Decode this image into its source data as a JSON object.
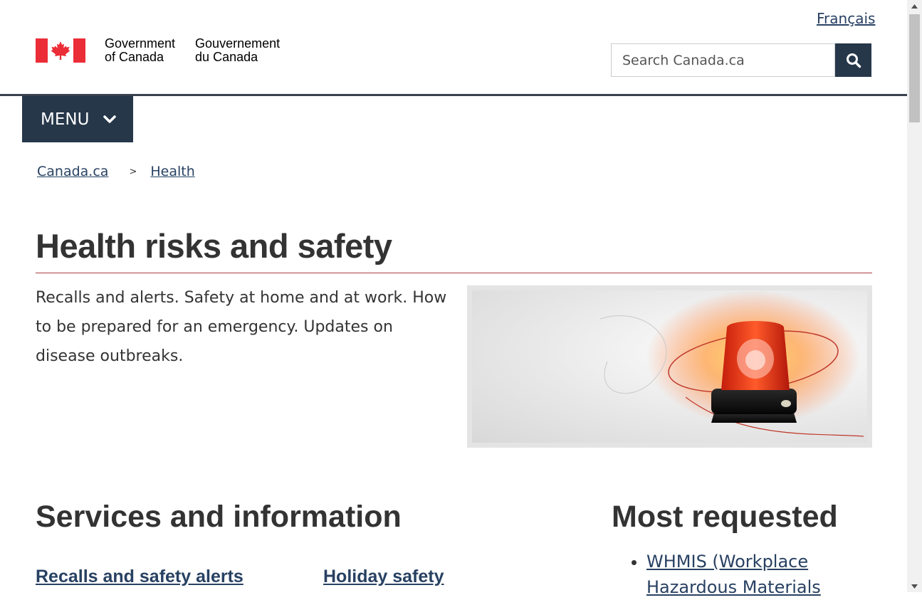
{
  "header": {
    "language_link": "Français",
    "wordmark_en": [
      "Government",
      "of Canada"
    ],
    "wordmark_fr": [
      "Gouvernement",
      "du Canada"
    ],
    "search_placeholder": "Search Canada.ca",
    "menu_label": "MENU"
  },
  "breadcrumb": {
    "items": [
      "Canada.ca",
      "Health"
    ],
    "separator": ">"
  },
  "page": {
    "title": "Health risks and safety",
    "intro": "Recalls and alerts. Safety at home and at work. How to be prepared for an emergency. Updates on disease outbreaks."
  },
  "services": {
    "heading": "Services and information",
    "links": [
      "Recalls and safety alerts",
      "Holiday safety"
    ]
  },
  "most_requested": {
    "heading": "Most requested",
    "items": [
      "WHMIS (Workplace Hazardous Materials"
    ]
  },
  "colors": {
    "brand_dark": "#26374a",
    "link": "#284162",
    "flag_red": "#eb2d37",
    "title_rule": "#af3c43"
  },
  "icons": {
    "search": "magnifier-icon",
    "menu_chevron": "chevron-down-icon",
    "flag": "canada-flag-icon"
  }
}
